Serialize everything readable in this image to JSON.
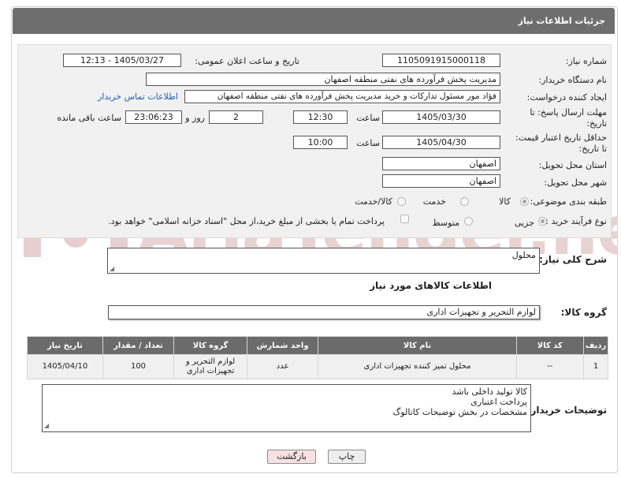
{
  "header": {
    "title": "جزئیات اطلاعات نیاز"
  },
  "form": {
    "need_number_label": "شماره نیاز:",
    "need_number": "1105091915000118",
    "announce_label": "تاریخ و ساعت اعلان عمومی:",
    "announce_value": "1405/03/27 - 12:13",
    "buyer_org_label": "نام دستگاه خریدار:",
    "buyer_org": "مدیریت پخش فرآورده های نفتی منطقه اصفهان",
    "creator_label": "ایجاد کننده درخواست:",
    "creator": "فؤاد مور مسئول تدارکات و خرید مدیریت پخش فرآورده های نفتی منطقه اصفهان",
    "contact_link": "اطلاعات تماس خریدار",
    "deadline_label_1": "مهلت ارسال پاسخ: تا",
    "deadline_label_2": "تاریخ:",
    "deadline_date": "1405/03/30",
    "time_label": "ساعت",
    "deadline_time": "12:30",
    "days_value": "2",
    "days_label": "روز و",
    "remaining_value": "23:06:23",
    "remaining_label": "ساعت باقی مانده",
    "validity_label_1": "حداقل تاریخ اعتبار قیمت:",
    "validity_label_2": "تا تاریخ:",
    "validity_date": "1405/04/30",
    "validity_time_label": "ساعت",
    "validity_time": "10:00",
    "province_label": "استان محل تحویل:",
    "province": "اصفهان",
    "city_label": "شهر محل تحویل:",
    "city": "اصفهان",
    "category_label": "طبقه بندی موضوعی:",
    "category_options": [
      "کالا",
      "خدمت",
      "کالا/خدمت"
    ],
    "process_label": "نوع فرآیند خرید :",
    "process_options": [
      "جزیی",
      "متوسط"
    ],
    "payment_note": "پرداخت تمام یا بخشی از مبلغ خرید،از محل \"اسناد خزانه اسلامی\" خواهد بود."
  },
  "description": {
    "label": "شرح کلی نیاز:",
    "value": "محلول"
  },
  "goods_section": {
    "title": "اطلاعات کالاهای مورد نیاز"
  },
  "goods_group": {
    "label": "گروه کالا:",
    "value": "لوازم التحریر و تجهیزات اداری"
  },
  "table": {
    "headers": [
      "ردیف",
      "کد کالا",
      "نام کالا",
      "واحد شمارش",
      "گروه کالا",
      "تعداد / مقدار",
      "تاریخ نیاز"
    ],
    "rows": [
      {
        "index": "1",
        "code": "--",
        "name": "محلول تمیز کننده تجهیزات اداری",
        "unit": "عدد",
        "group": "لوازم التحریر و تجهیزات اداری",
        "qty": "100",
        "date": "1405/04/10"
      }
    ]
  },
  "buyer_notes": {
    "label": "توضیحات خریدار:",
    "lines": [
      "کالا تولید داخلی باشد",
      "پرداخت اعتباری",
      "مشخصات در بخش توضیحات کاتالوگ"
    ]
  },
  "buttons": {
    "print": "چاپ",
    "back": "بازگشت"
  },
  "watermark": {
    "text": "AriaTender.neT"
  },
  "colors": {
    "header_bg": "#6e6e6e",
    "link": "#1f5fb5",
    "back_button_bg": "#f9e1e1",
    "print_button_bg": "#eeeeee",
    "watermark": "#e5c9c9"
  }
}
